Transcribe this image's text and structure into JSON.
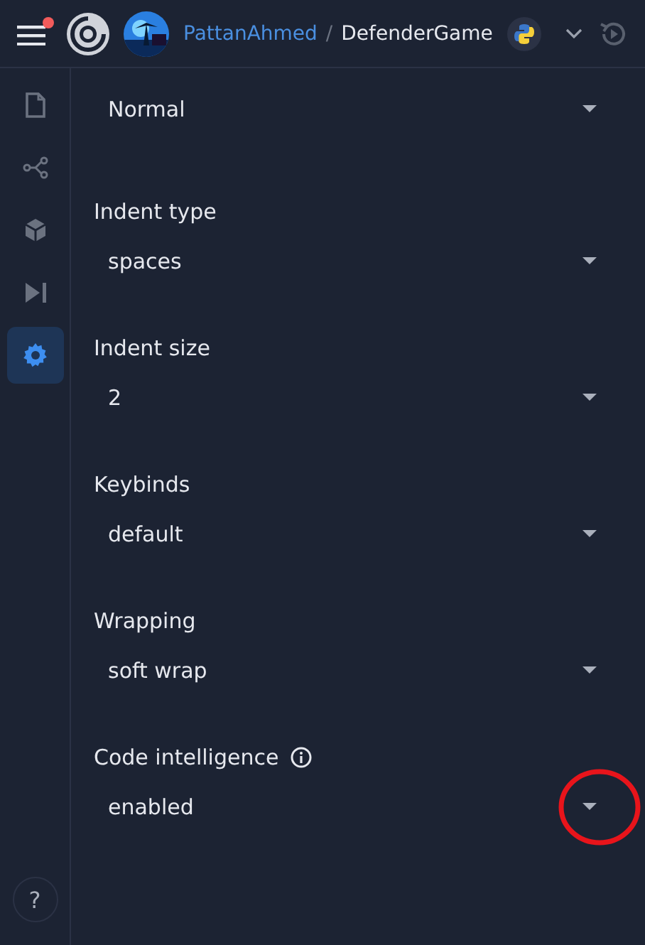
{
  "top_bar": {
    "notification_dot": true,
    "owner": "PattanAhmed",
    "separator": "/",
    "repl": "DefenderGame"
  },
  "sidebar": {
    "items": [
      {
        "kind": "file",
        "selected": false
      },
      {
        "kind": "share",
        "selected": false
      },
      {
        "kind": "cube",
        "selected": false
      },
      {
        "kind": "step",
        "selected": false
      },
      {
        "kind": "gear",
        "selected": true
      }
    ],
    "help": "?"
  },
  "settings": [
    {
      "value": "Normal",
      "circled": false
    },
    {
      "label": "Indent type",
      "value": "spaces",
      "circled": false
    },
    {
      "label": "Indent size",
      "value": "2",
      "circled": false
    },
    {
      "label": "Keybinds",
      "value": "default",
      "circled": false
    },
    {
      "label": "Wrapping",
      "value": "soft wrap",
      "circled": false
    },
    {
      "label": "Code intelligence",
      "info": true,
      "value": "enabled",
      "circled": true
    }
  ]
}
